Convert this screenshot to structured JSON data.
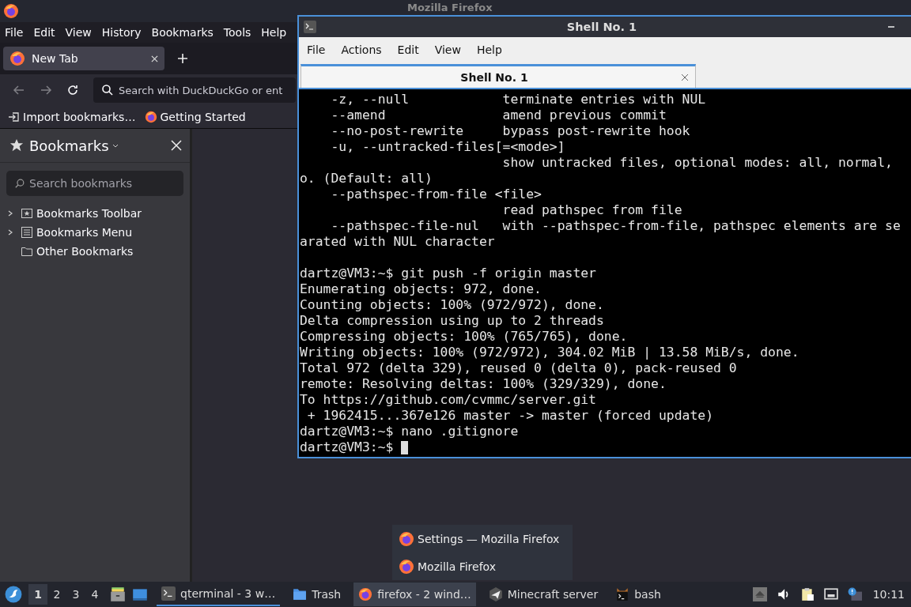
{
  "firefox": {
    "title": "Mozilla Firefox",
    "menu": [
      "File",
      "Edit",
      "View",
      "History",
      "Bookmarks",
      "Tools",
      "Help"
    ],
    "tabs": [
      {
        "label": "New Tab",
        "selected": true
      }
    ],
    "back": {
      "disabled": true
    },
    "forward": {
      "disabled": true
    },
    "urlbar": {
      "placeholder": "Search with DuckDuckGo or ent"
    },
    "bookmarks_bar": [
      {
        "label": "Import bookmarks…",
        "kind": "import"
      },
      {
        "label": "Getting Started",
        "kind": "firefox"
      }
    ],
    "sidebar": {
      "title": "Bookmarks",
      "search": {
        "placeholder": "Search bookmarks"
      },
      "tree": [
        {
          "label": "Bookmarks Toolbar",
          "kind": "toolbar",
          "expanded": false
        },
        {
          "label": "Bookmarks Menu",
          "kind": "menu",
          "expanded": false
        },
        {
          "label": "Other Bookmarks",
          "kind": "folder"
        }
      ]
    }
  },
  "terminal": {
    "title": "Shell No. 1",
    "menu": [
      "File",
      "Actions",
      "Edit",
      "View",
      "Help"
    ],
    "tabs": [
      {
        "label": "Shell No. 1",
        "selected": true
      }
    ],
    "blocks": [
      [
        "    -z, --null            terminate entries with NUL",
        "    --amend               amend previous commit",
        "    --no-post-rewrite     bypass post-rewrite hook",
        "    -u, --untracked-files[=<mode>]",
        "                          show untracked files, optional modes: all, normal,",
        "o. (Default: all)",
        "    --pathspec-from-file <file>",
        "                          read pathspec from file",
        "    --pathspec-file-nul   with --pathspec-from-file, pathspec elements are se",
        "arated with NUL character"
      ],
      [
        "dartz@VM3:~$ git push -f origin master",
        "Enumerating objects: 972, done.",
        "Counting objects: 100% (972/972), done.",
        "Delta compression using up to 2 threads",
        "Compressing objects: 100% (765/765), done.",
        "Writing objects: 100% (972/972), 304.02 MiB | 13.58 MiB/s, done.",
        "Total 972 (delta 329), reused 0 (delta 0), pack-reused 0",
        "remote: Resolving deltas: 100% (329/329), done.",
        "To https://github.com/cvmmc/server.git",
        " + 1962415...367e126 master -> master (forced update)",
        "dartz@VM3:~$ nano .gitignore",
        "dartz@VM3:~$ "
      ]
    ],
    "cursor": true
  },
  "popup": [
    {
      "label": "Settings — Mozilla Firefox"
    },
    {
      "label": "Mozilla Firefox"
    }
  ],
  "taskbar": {
    "workspaces": [
      {
        "label": "1",
        "selected": true
      },
      {
        "label": "2",
        "selected": false
      },
      {
        "label": "3",
        "selected": false
      },
      {
        "label": "4",
        "selected": false
      }
    ],
    "tasks": [
      {
        "label": "qterminal - 3 w…",
        "kind": "terminal",
        "selected": false,
        "active": true
      },
      {
        "label": "Trash",
        "kind": "folder",
        "selected": false,
        "active": false
      },
      {
        "label": "firefox - 2 wind…",
        "kind": "firefox",
        "selected": true,
        "active": false
      },
      {
        "label": "Minecraft server",
        "kind": "plane",
        "selected": false,
        "active": false
      },
      {
        "label": "bash",
        "kind": "bash",
        "selected": false,
        "active": false
      }
    ],
    "clock": "10:11"
  }
}
